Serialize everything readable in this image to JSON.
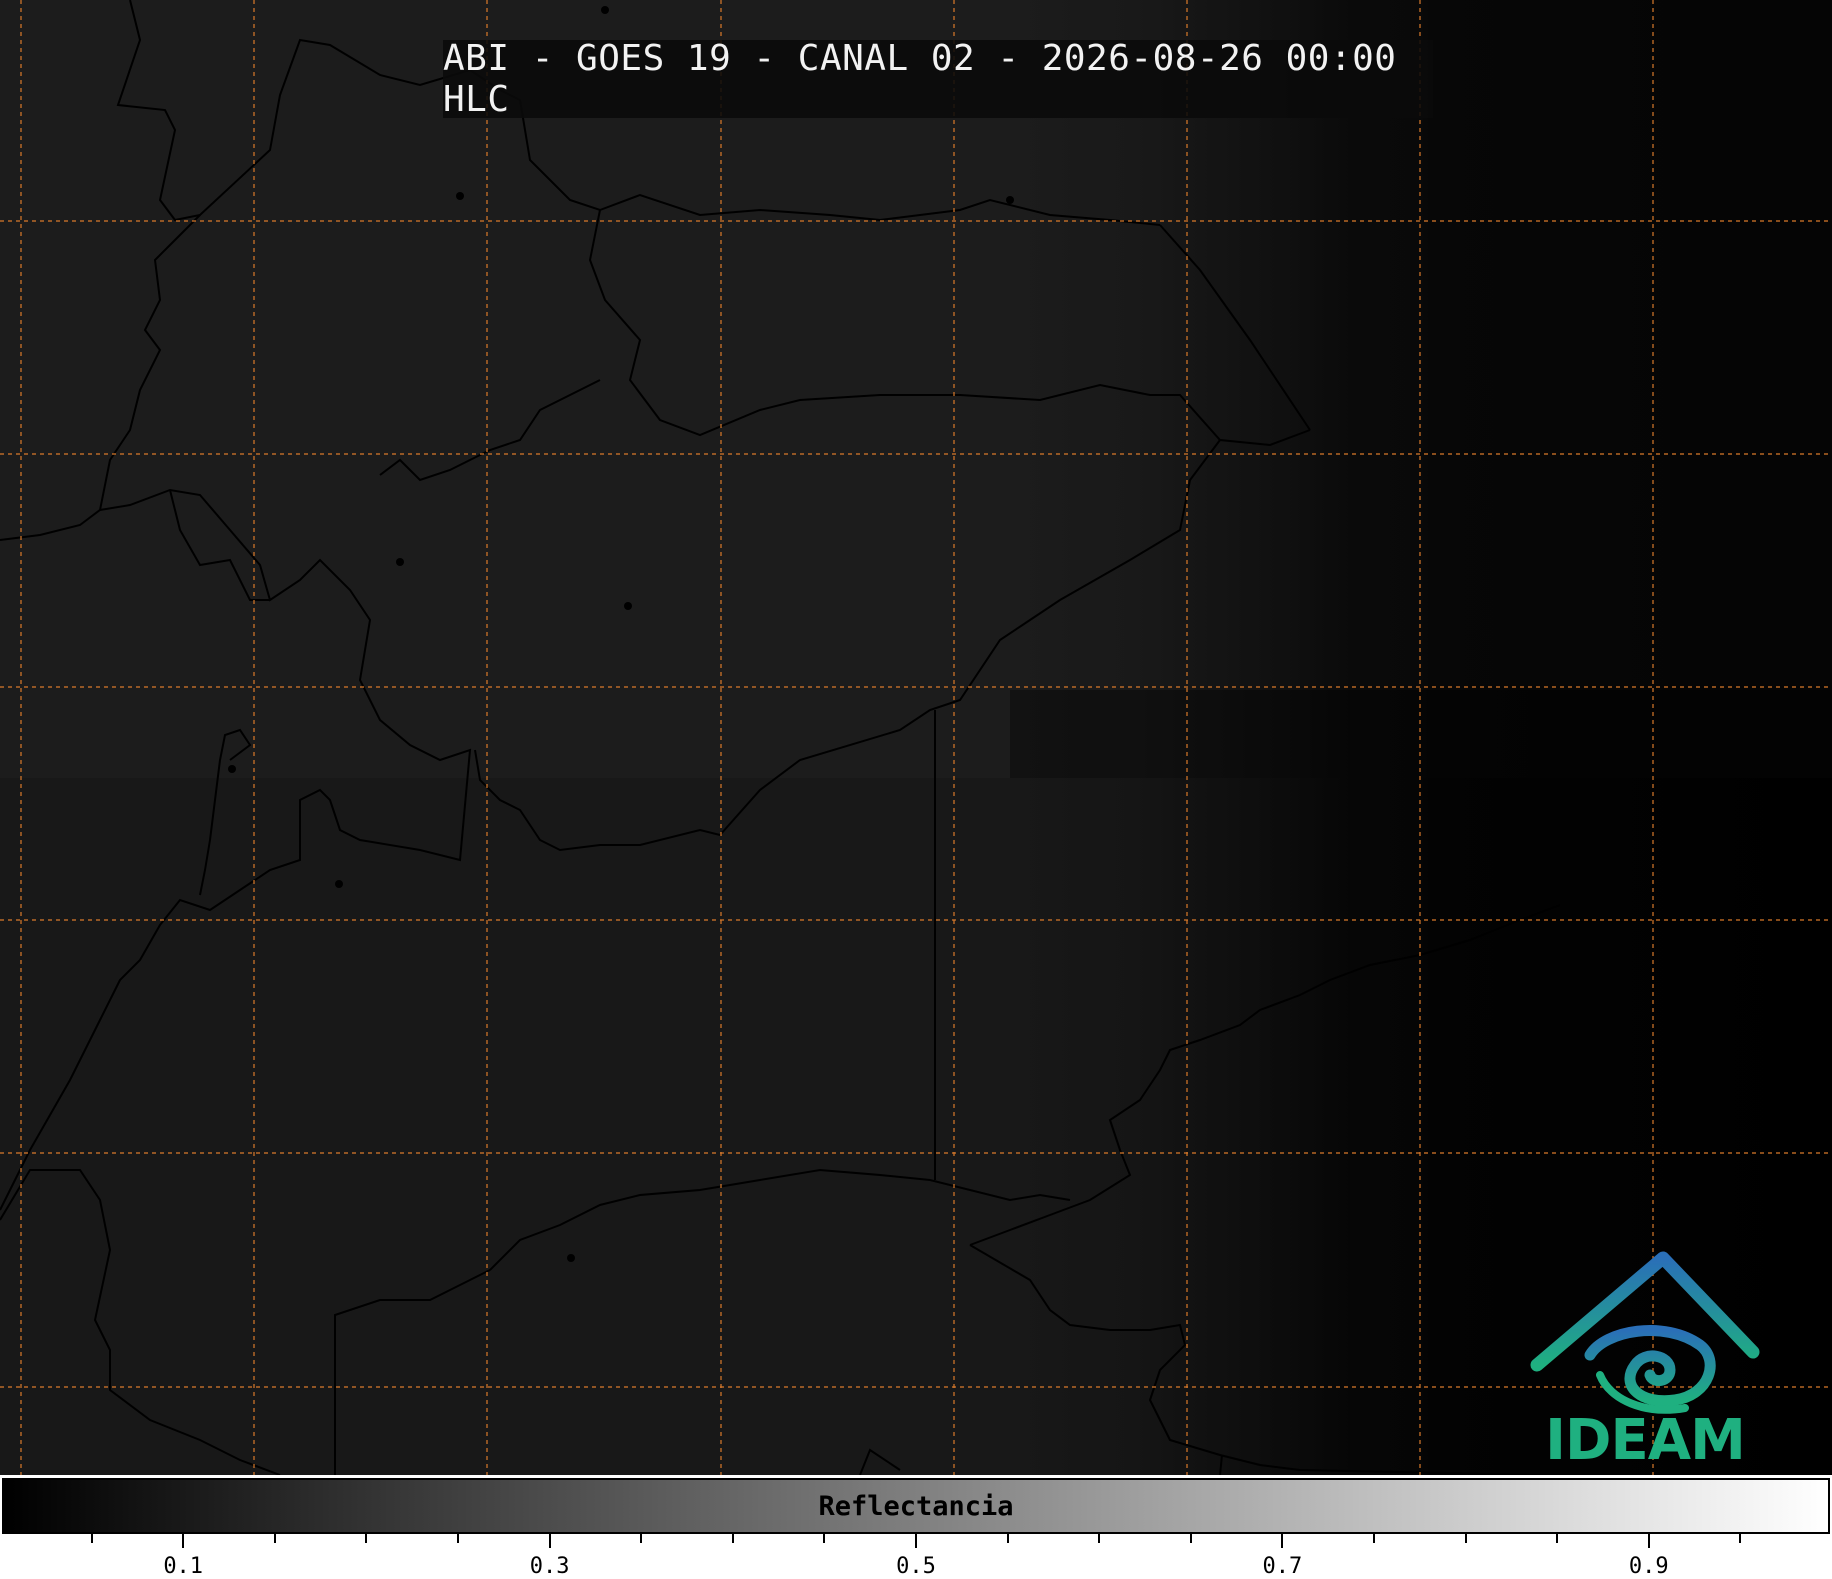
{
  "title": "ABI - GOES 19 - CANAL 02 - 2026-08-26 00:00 HLC",
  "colorbar": {
    "label": "Reflectancia",
    "min": 0.0,
    "max": 1.0,
    "major_ticks": [
      "0.1",
      "0.3",
      "0.5",
      "0.7",
      "0.9"
    ],
    "minor_step": 0.05
  },
  "logo": {
    "text": "IDEAM"
  },
  "colors": {
    "gridline": "#d97a2b",
    "border_line": "#000000",
    "logo_green": "#1fb080",
    "logo_blue": "#2a6fb8"
  }
}
